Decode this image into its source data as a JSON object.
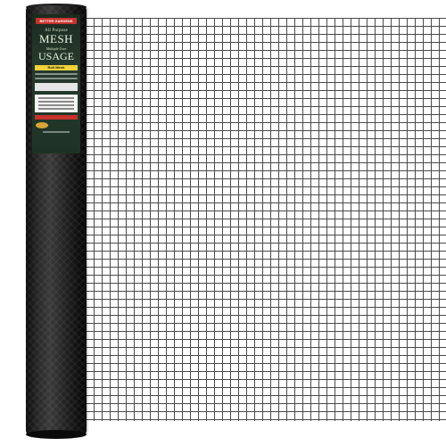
{
  "product": {
    "brand_bar": "BETTER GARDENS",
    "line1": "All Purpose",
    "title": "MESH",
    "subtitle": "Multiple Uses",
    "title2": "USAGE",
    "feature_bar": "Roll Mesh"
  },
  "colors": {
    "mesh_wire": "#4a4a4a",
    "roll_body": "#1a1a1a",
    "label_green": "#253a2c",
    "accent_red": "#c8322d",
    "accent_yellow": "#f0d23a"
  }
}
